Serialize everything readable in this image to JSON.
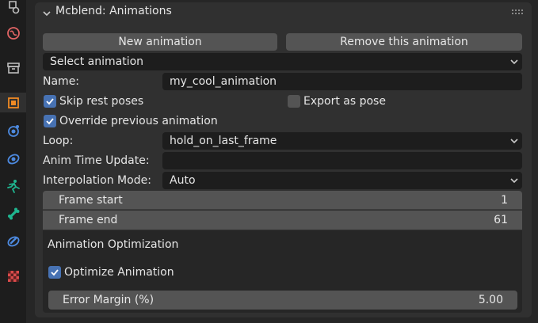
{
  "sidebar": {
    "tabs": [
      {
        "icon": "scene-icon",
        "color": "#bdbdbd"
      },
      {
        "icon": "world-icon",
        "color": "#e06464"
      },
      {
        "icon": "collection-icon",
        "color": "#bdbdbd"
      },
      {
        "icon": "object-icon",
        "color": "#f08a24"
      },
      {
        "icon": "physics-icon",
        "color": "#4d8ae0"
      },
      {
        "icon": "constraints-icon",
        "color": "#4d8ae0"
      },
      {
        "icon": "object-data-armature-icon",
        "color": "#1fb58f"
      },
      {
        "icon": "bone-icon",
        "color": "#1fb58f"
      },
      {
        "icon": "bone-constraint-icon",
        "color": "#4d8ae0"
      },
      {
        "icon": "texture-icon",
        "color": "#d94b4b"
      }
    ]
  },
  "panel": {
    "title": "Mcblend: Animations"
  },
  "buttons": {
    "new_animation": "New animation",
    "remove_animation": "Remove this animation"
  },
  "select_animation": {
    "value": "Select animation"
  },
  "fields": {
    "name_label": "Name:",
    "name_value": "my_cool_animation",
    "skip_rest_poses": "Skip rest poses",
    "skip_rest_poses_checked": true,
    "export_as_pose": "Export as pose",
    "export_as_pose_checked": false,
    "override_previous": "Override previous animation",
    "override_previous_checked": true,
    "loop_label": "Loop:",
    "loop_value": "hold_on_last_frame",
    "anim_time_label": "Anim Time Update:",
    "anim_time_value": "",
    "interp_label": "Interpolation Mode:",
    "interp_value": "Auto",
    "frame_start_label": "Frame start",
    "frame_start_value": "1",
    "frame_end_label": "Frame end",
    "frame_end_value": "61"
  },
  "optimization": {
    "title": "Animation Optimization",
    "optimize_label": "Optimize Animation",
    "optimize_checked": true,
    "error_margin_label": "Error Margin (%)",
    "error_margin_value": "5.00"
  },
  "colors": {
    "accent": "#4772b3",
    "panel": "#303030",
    "field": "#1d1d1d",
    "button": "#545454"
  }
}
